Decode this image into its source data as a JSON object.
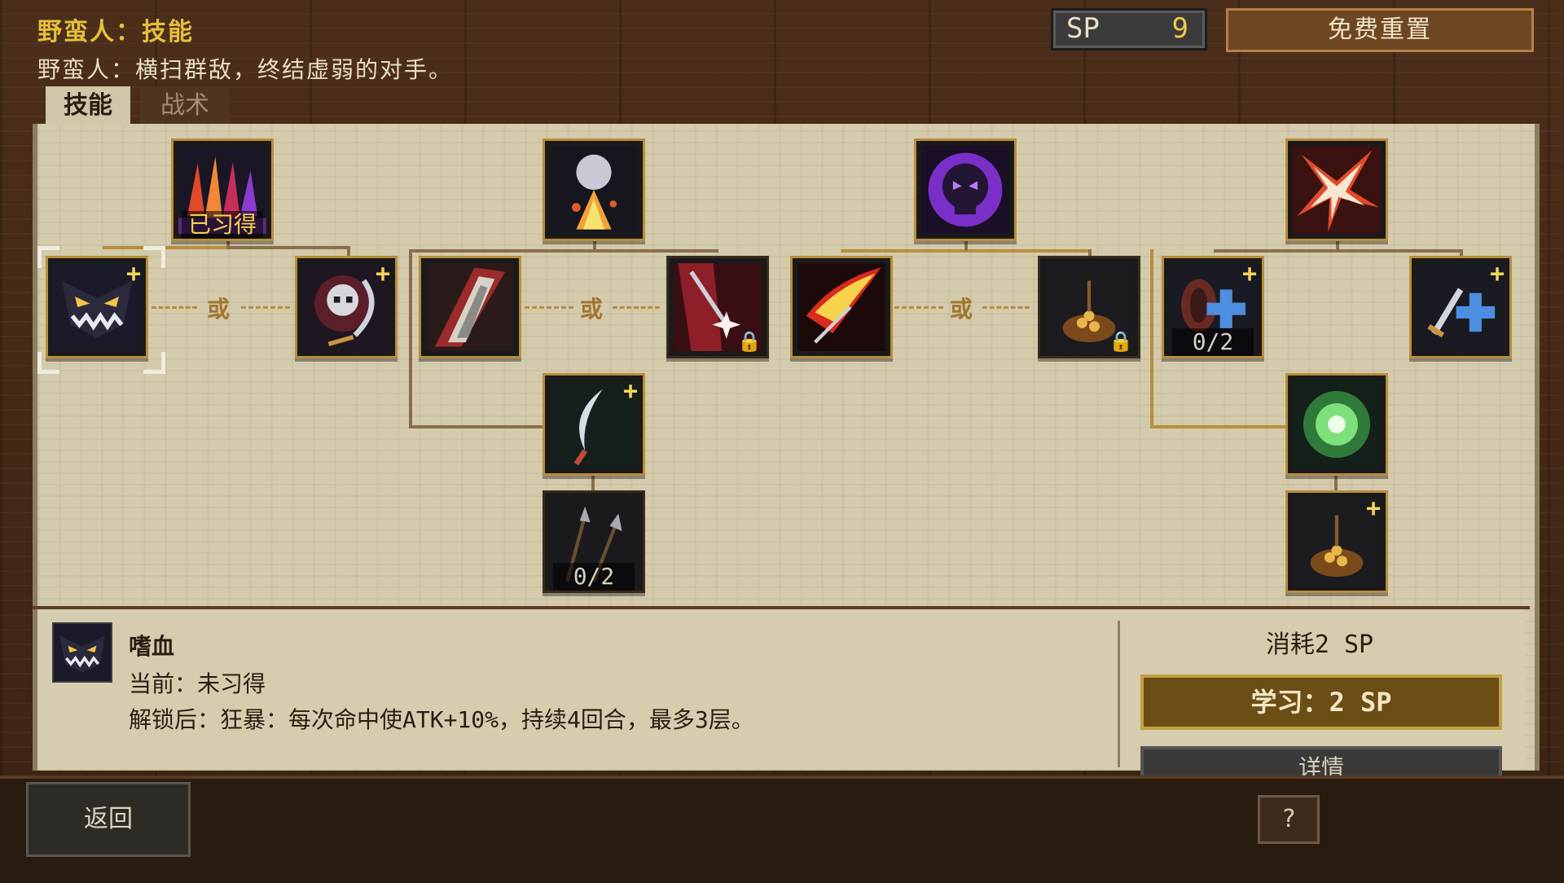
{
  "header": {
    "title": "野蛮人：技能",
    "subtitle": "野蛮人：横扫群敌，终结虚弱的对手。",
    "sp_label": "SP",
    "sp_value": "9",
    "reset_label": "免费重置"
  },
  "tabs": [
    {
      "label": "技能",
      "active": true
    },
    {
      "label": "战术",
      "active": false
    }
  ],
  "tree": {
    "or_label": "或",
    "learned_label": "已习得",
    "nodes": [
      {
        "id": "fire-claws",
        "icon": "fire-claws-icon",
        "label": "已习得"
      },
      {
        "id": "bloodthirst",
        "icon": "monster-face-icon",
        "plus": true
      },
      {
        "id": "reaper",
        "icon": "skull-scythe-icon",
        "plus": true
      },
      {
        "id": "ground-slam",
        "icon": "explosion-fist-icon"
      },
      {
        "id": "blade-sweep",
        "icon": "blade-sweep-icon"
      },
      {
        "id": "star-strike",
        "icon": "star-strike-icon",
        "locked": true
      },
      {
        "id": "crescent-blade",
        "icon": "crescent-blade-icon",
        "plus": true
      },
      {
        "id": "twin-spears",
        "icon": "twin-spears-icon",
        "locked": true,
        "label": "0/2"
      },
      {
        "id": "terror",
        "icon": "purple-skull-icon"
      },
      {
        "id": "power-slash",
        "icon": "red-arrow-icon"
      },
      {
        "id": "gold-pile",
        "icon": "gold-pile-icon",
        "locked": true
      },
      {
        "id": "burst",
        "icon": "burst-icon"
      },
      {
        "id": "shield-heal",
        "icon": "shield-heal-icon",
        "plus": true,
        "label": "0/2"
      },
      {
        "id": "sword-heal",
        "icon": "sword-heal-icon",
        "plus": true
      },
      {
        "id": "green-aura",
        "icon": "green-aura-icon"
      },
      {
        "id": "gold-pile-2",
        "icon": "gold-pile-icon",
        "plus": true
      }
    ]
  },
  "info": {
    "name": "嗜血",
    "current": "当前：未习得",
    "unlock": "解锁后：狂暴：每次命中使ATK+10%，持续4回合，最多3层。",
    "cost": "消耗2 SP",
    "learn_label": "学习：2 SP",
    "detail_label": "详情"
  },
  "footer": {
    "back_label": "返回",
    "help_label": "?"
  },
  "colors": {
    "accent_gold": "#e6bf3c",
    "panel": "#d4cbad",
    "node_border": "#b98d3b"
  }
}
